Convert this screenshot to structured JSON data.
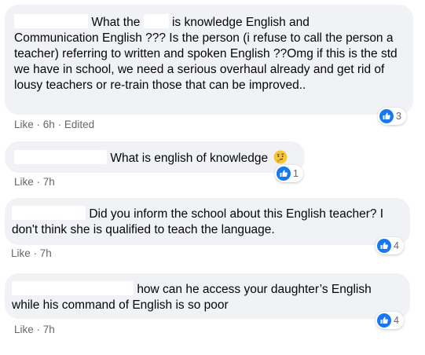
{
  "comments": [
    {
      "line1_a": "What the",
      "line1_b": "is knowledge English and",
      "rest": "Communication English ??? Is the person (i refuse to call the person a teacher) referring to written and spoken English ??Omg if this is the std we have in school, we need a serious overhaul already and get rid of lousy teachers or re-train those that can be improved..",
      "like_label": "Like",
      "time": "6h",
      "edited": "Edited",
      "reactions": "3"
    },
    {
      "text": "What is english of knowledge",
      "emoji_name": "thinking-face-icon",
      "like_label": "Like",
      "time": "7h",
      "reactions": "1"
    },
    {
      "line1": "Did you inform the school about this English teacher? I",
      "rest": "don't think she is qualified to teach the language.",
      "like_label": "Like",
      "time": "7h",
      "reactions": "4"
    },
    {
      "line1": "how can he access your daughter’s English",
      "rest": "while his command of English is so poor",
      "like_label": "Like",
      "time": "7h",
      "reactions": "4"
    }
  ],
  "separator": "·",
  "colors": {
    "bubble": "#f0f2f5",
    "meta": "#65676b",
    "like_blue": "#1877f2"
  }
}
